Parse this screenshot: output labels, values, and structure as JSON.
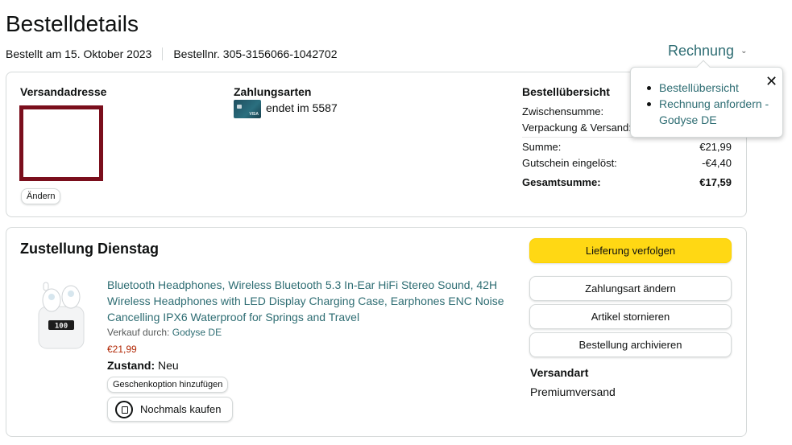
{
  "page_title": "Bestelldetails",
  "order_meta": {
    "ordered": "Bestellt am 15. Oktober 2023",
    "order_number": "Bestellnr. 305-3156066-1042702"
  },
  "invoice_menu": {
    "label": "Rechnung",
    "items": [
      "Bestellübersicht",
      "Rechnung anfordern - Godyse DE"
    ],
    "close_icon": "close-icon"
  },
  "shipping_address": {
    "heading": "Versandadresse",
    "change_label": "Ändern"
  },
  "payment": {
    "heading": "Zahlungsarten",
    "card_text": "endet im 5587",
    "card_icon": "credit-card-icon",
    "card_brand_mark": "VISA"
  },
  "summary": {
    "heading": "Bestellübersicht",
    "rows": [
      {
        "label": "Zwischensumme:",
        "value": ""
      },
      {
        "label": "Verpackung & Versand:",
        "value": ""
      },
      {
        "label": "Summe:",
        "value": "€21,99"
      },
      {
        "label": "Gutschein eingelöst:",
        "value": "-€4,40"
      },
      {
        "label": "Gesamtsumme:",
        "value": "€17,59"
      }
    ]
  },
  "delivery": {
    "heading": "Zustellung Dienstag",
    "product": {
      "title": "Bluetooth Headphones, Wireless Bluetooth 5.3 In-Ear HiFi Stereo Sound, 42H Wireless Headphones with LED Display Charging Case, Earphones ENC Noise Cancelling IPX6 Waterproof for Springs and Travel",
      "seller_label": "Verkauf durch:",
      "seller_name": "Godyse DE",
      "price": "€21,99",
      "condition_label": "Zustand:",
      "condition_value": "Neu",
      "case_display": "100",
      "gift_label": "Geschenkoption hinzufügen",
      "buy_again_label": "Nochmals kaufen"
    },
    "actions": {
      "track": "Lieferung verfolgen",
      "change_payment": "Zahlungsart ändern",
      "cancel": "Artikel stornieren",
      "archive": "Bestellung archivieren"
    },
    "shipping_method_label": "Versandart",
    "shipping_method_value": "Premiumversand"
  },
  "colors": {
    "link": "#2e6d73",
    "price": "#b12704",
    "primary_button": "#ffd814",
    "address_frame": "#7a0e1c"
  }
}
